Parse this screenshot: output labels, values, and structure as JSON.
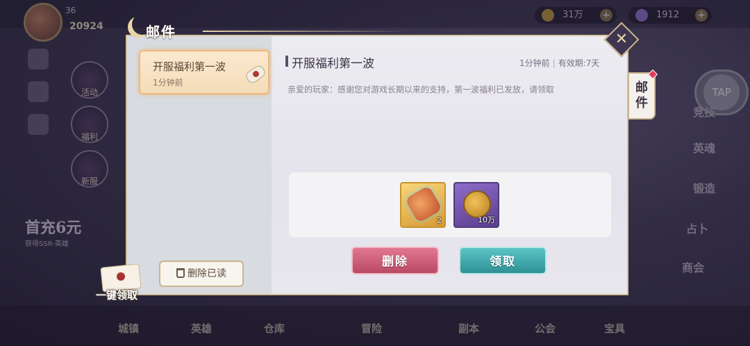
{
  "hud": {
    "level": "36",
    "power": "20924",
    "coins": "31万",
    "gems": "1912"
  },
  "side_buttons": [
    "活动",
    "福利",
    "新服"
  ],
  "promo": {
    "title": "首充6元",
    "subtitle": "获得SSR·英雄"
  },
  "right_menu": [
    "竞技",
    "英魂",
    "锻造",
    "占卜",
    "商会"
  ],
  "tap_label": "TAP",
  "bottom_menu": [
    "城镇",
    "英雄",
    "仓库",
    "冒险",
    "副本",
    "公会",
    "宝具"
  ],
  "mail_panel": {
    "title": "邮件",
    "side_tab": "邮件",
    "list": [
      {
        "title": "开服福利第一波",
        "time": "1分钟前"
      }
    ],
    "detail": {
      "title": "开服福利第一波",
      "time": "1分钟前",
      "validity": "有效期:7天",
      "body": "亲爱的玩家：感谢您对游戏长期以来的支持，第一波福利已发放，请领取",
      "rewards": [
        {
          "icon": "scroll-item-icon",
          "qty": "2"
        },
        {
          "icon": "gold-coin-icon",
          "qty": "10万"
        }
      ]
    },
    "buttons": {
      "delete": "删除",
      "claim": "领取",
      "delete_read": "删除已读",
      "claim_all": "一键领取"
    }
  },
  "colors": {
    "panel_border": "#d4c19a",
    "delete_button": "#c95a74",
    "claim_button": "#3ea7ab",
    "selected_item": "#f4dcb8"
  }
}
